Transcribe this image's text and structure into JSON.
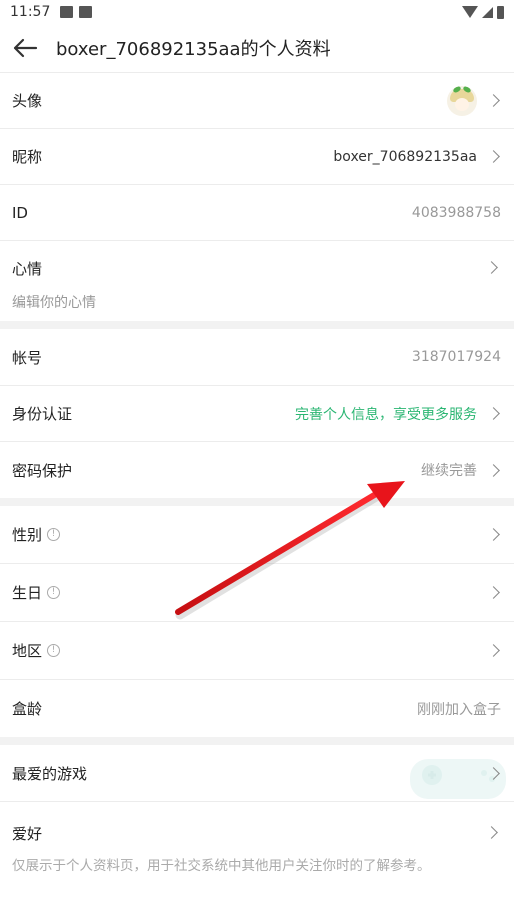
{
  "status_bar": {
    "time": "11:57"
  },
  "header": {
    "title": "boxer_706892135aa的个人资料"
  },
  "rows": {
    "avatar": {
      "label": "头像"
    },
    "nickname": {
      "label": "昵称",
      "value": "boxer_706892135aa"
    },
    "id": {
      "label": "ID",
      "value": "4083988758"
    },
    "mood": {
      "label": "心情",
      "placeholder": "编辑你的心情"
    },
    "account": {
      "label": "帐号",
      "value": "3187017924"
    },
    "identity": {
      "label": "身份认证",
      "value": "完善个人信息，享受更多服务"
    },
    "password": {
      "label": "密码保护",
      "value": "继续完善"
    },
    "gender": {
      "label": "性别"
    },
    "birthday": {
      "label": "生日"
    },
    "region": {
      "label": "地区"
    },
    "box_age": {
      "label": "盒龄",
      "value": "刚刚加入盒子"
    },
    "fav_games": {
      "label": "最爱的游戏"
    },
    "hobby": {
      "label": "爱好",
      "description": "仅展示于个人资料页，用于社交系统中其他用户关注你时的了解参考。"
    }
  },
  "colors": {
    "accent_green": "#2bb673",
    "arrow_red": "#e8141b"
  },
  "icons": [
    "back-arrow-icon",
    "chevron-right-icon",
    "info-icon",
    "wifi-icon",
    "signal-icon",
    "battery-icon"
  ]
}
